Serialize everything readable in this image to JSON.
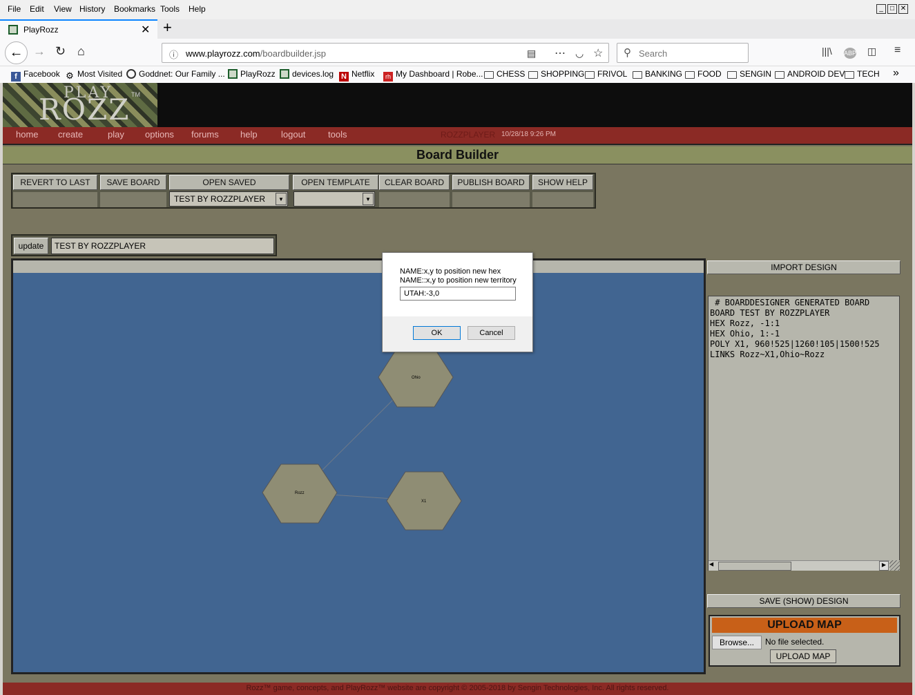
{
  "menu": [
    "File",
    "Edit",
    "View",
    "History",
    "Bookmarks",
    "Tools",
    "Help"
  ],
  "tab": {
    "title": "PlayRozz"
  },
  "nav": {
    "url_host": "www.playrozz.com",
    "url_path": "/boardbuilder.jsp",
    "search_placeholder": "Search"
  },
  "bookmarks": [
    {
      "label": "Facebook",
      "icon": "facebook-icon"
    },
    {
      "label": "Most Visited",
      "icon": "gear-icon"
    },
    {
      "label": "Goddnet: Our Family ...",
      "icon": "globe-icon"
    },
    {
      "label": "PlayRozz",
      "icon": "playrozz-icon"
    },
    {
      "label": "devices.log",
      "icon": "playrozz-icon"
    },
    {
      "label": "Netflix",
      "icon": "netflix-icon"
    },
    {
      "label": "My Dashboard | Robe...",
      "icon": "robinhood-icon"
    },
    {
      "label": "CHESS",
      "icon": "folder-icon"
    },
    {
      "label": "SHOPPING",
      "icon": "folder-icon"
    },
    {
      "label": "FRIVOL",
      "icon": "folder-icon"
    },
    {
      "label": "BANKING",
      "icon": "folder-icon"
    },
    {
      "label": "FOOD",
      "icon": "folder-icon"
    },
    {
      "label": "SENGIN",
      "icon": "folder-icon"
    },
    {
      "label": "ANDROID DEV",
      "icon": "folder-icon"
    },
    {
      "label": "TECH",
      "icon": "folder-icon"
    }
  ],
  "logo": {
    "line1": "PLAY",
    "line2": "ROZZ",
    "tm": "TM"
  },
  "site_nav": [
    "home",
    "create",
    "play",
    "options",
    "forums",
    "help",
    "logout",
    "tools"
  ],
  "user": {
    "name": "ROZZPLAYER",
    "datetime": "10/28/18 9:26 PM"
  },
  "page_title": "Board Builder",
  "toolbar": {
    "revert": "REVERT TO LAST",
    "save": "SAVE BOARD",
    "open_saved": "OPEN SAVED",
    "open_template": "OPEN TEMPLATE",
    "clear": "CLEAR BOARD",
    "publish": "PUBLISH BOARD",
    "help": "SHOW HELP",
    "saved_selected": "TEST BY ROZZPLAYER",
    "template_selected": ""
  },
  "name_row": {
    "update": "update",
    "board_name": "TEST BY ROZZPLAYER"
  },
  "board": {
    "background": "#416591",
    "hex_color": "#8f8d74",
    "hexes": [
      {
        "label": "Ohio"
      },
      {
        "label": "Rozz"
      },
      {
        "label": "X1"
      }
    ]
  },
  "right_panel": {
    "import": "IMPORT DESIGN",
    "design_text": " # BOARDDESIGNER GENERATED BOARD\nBOARD TEST BY ROZZPLAYER\nHEX Rozz, -1:1\nHEX Ohio, 1:-1\nPOLY X1, 960!525|1260!105|1500!525\nLINKS Rozz~X1,Ohio~Rozz",
    "save_show": "SAVE (SHOW) DESIGN",
    "upload_title": "UPLOAD MAP",
    "browse": "Browse...",
    "no_file": "No file selected.",
    "upload_btn": "UPLOAD MAP"
  },
  "footer": "Rozz™ game, concepts, and PlayRozz™ website are copyright © 2005-2018 by Sengin Technologies, Inc. All rights reserved.",
  "dialog": {
    "line1": "NAME:x,y to position new hex",
    "line2": "NAME::x,y to position new territory",
    "value": "UTAH:-3,0",
    "ok": "OK",
    "cancel": "Cancel"
  }
}
